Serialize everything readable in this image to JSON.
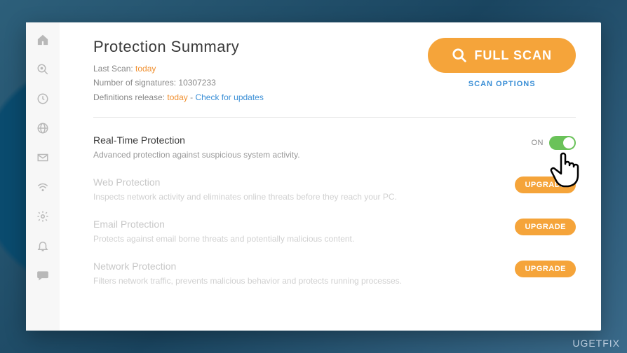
{
  "header": {
    "title": "Protection Summary",
    "last_scan_label": "Last Scan:",
    "last_scan_value": "today",
    "signatures_label": "Number of signatures:",
    "signatures_value": "10307233",
    "definitions_label": "Definitions release:",
    "definitions_value": "today",
    "separator": "-",
    "check_updates": "Check for updates",
    "full_scan": "FULL SCAN",
    "scan_options": "SCAN OPTIONS"
  },
  "sections": {
    "realtime": {
      "title": "Real-Time Protection",
      "desc": "Advanced protection against suspicious system activity.",
      "toggle_state": "ON"
    },
    "web": {
      "title": "Web Protection",
      "desc": "Inspects network activity and eliminates online threats before they reach your PC.",
      "action": "UPGRADE"
    },
    "email": {
      "title": "Email Protection",
      "desc": "Protects against email borne threats and potentially malicious content.",
      "action": "UPGRADE"
    },
    "network": {
      "title": "Network Protection",
      "desc": "Filters network traffic, prevents malicious behavior and protects running processes.",
      "action": "UPGRADE"
    }
  },
  "watermark": "UGETFIX"
}
